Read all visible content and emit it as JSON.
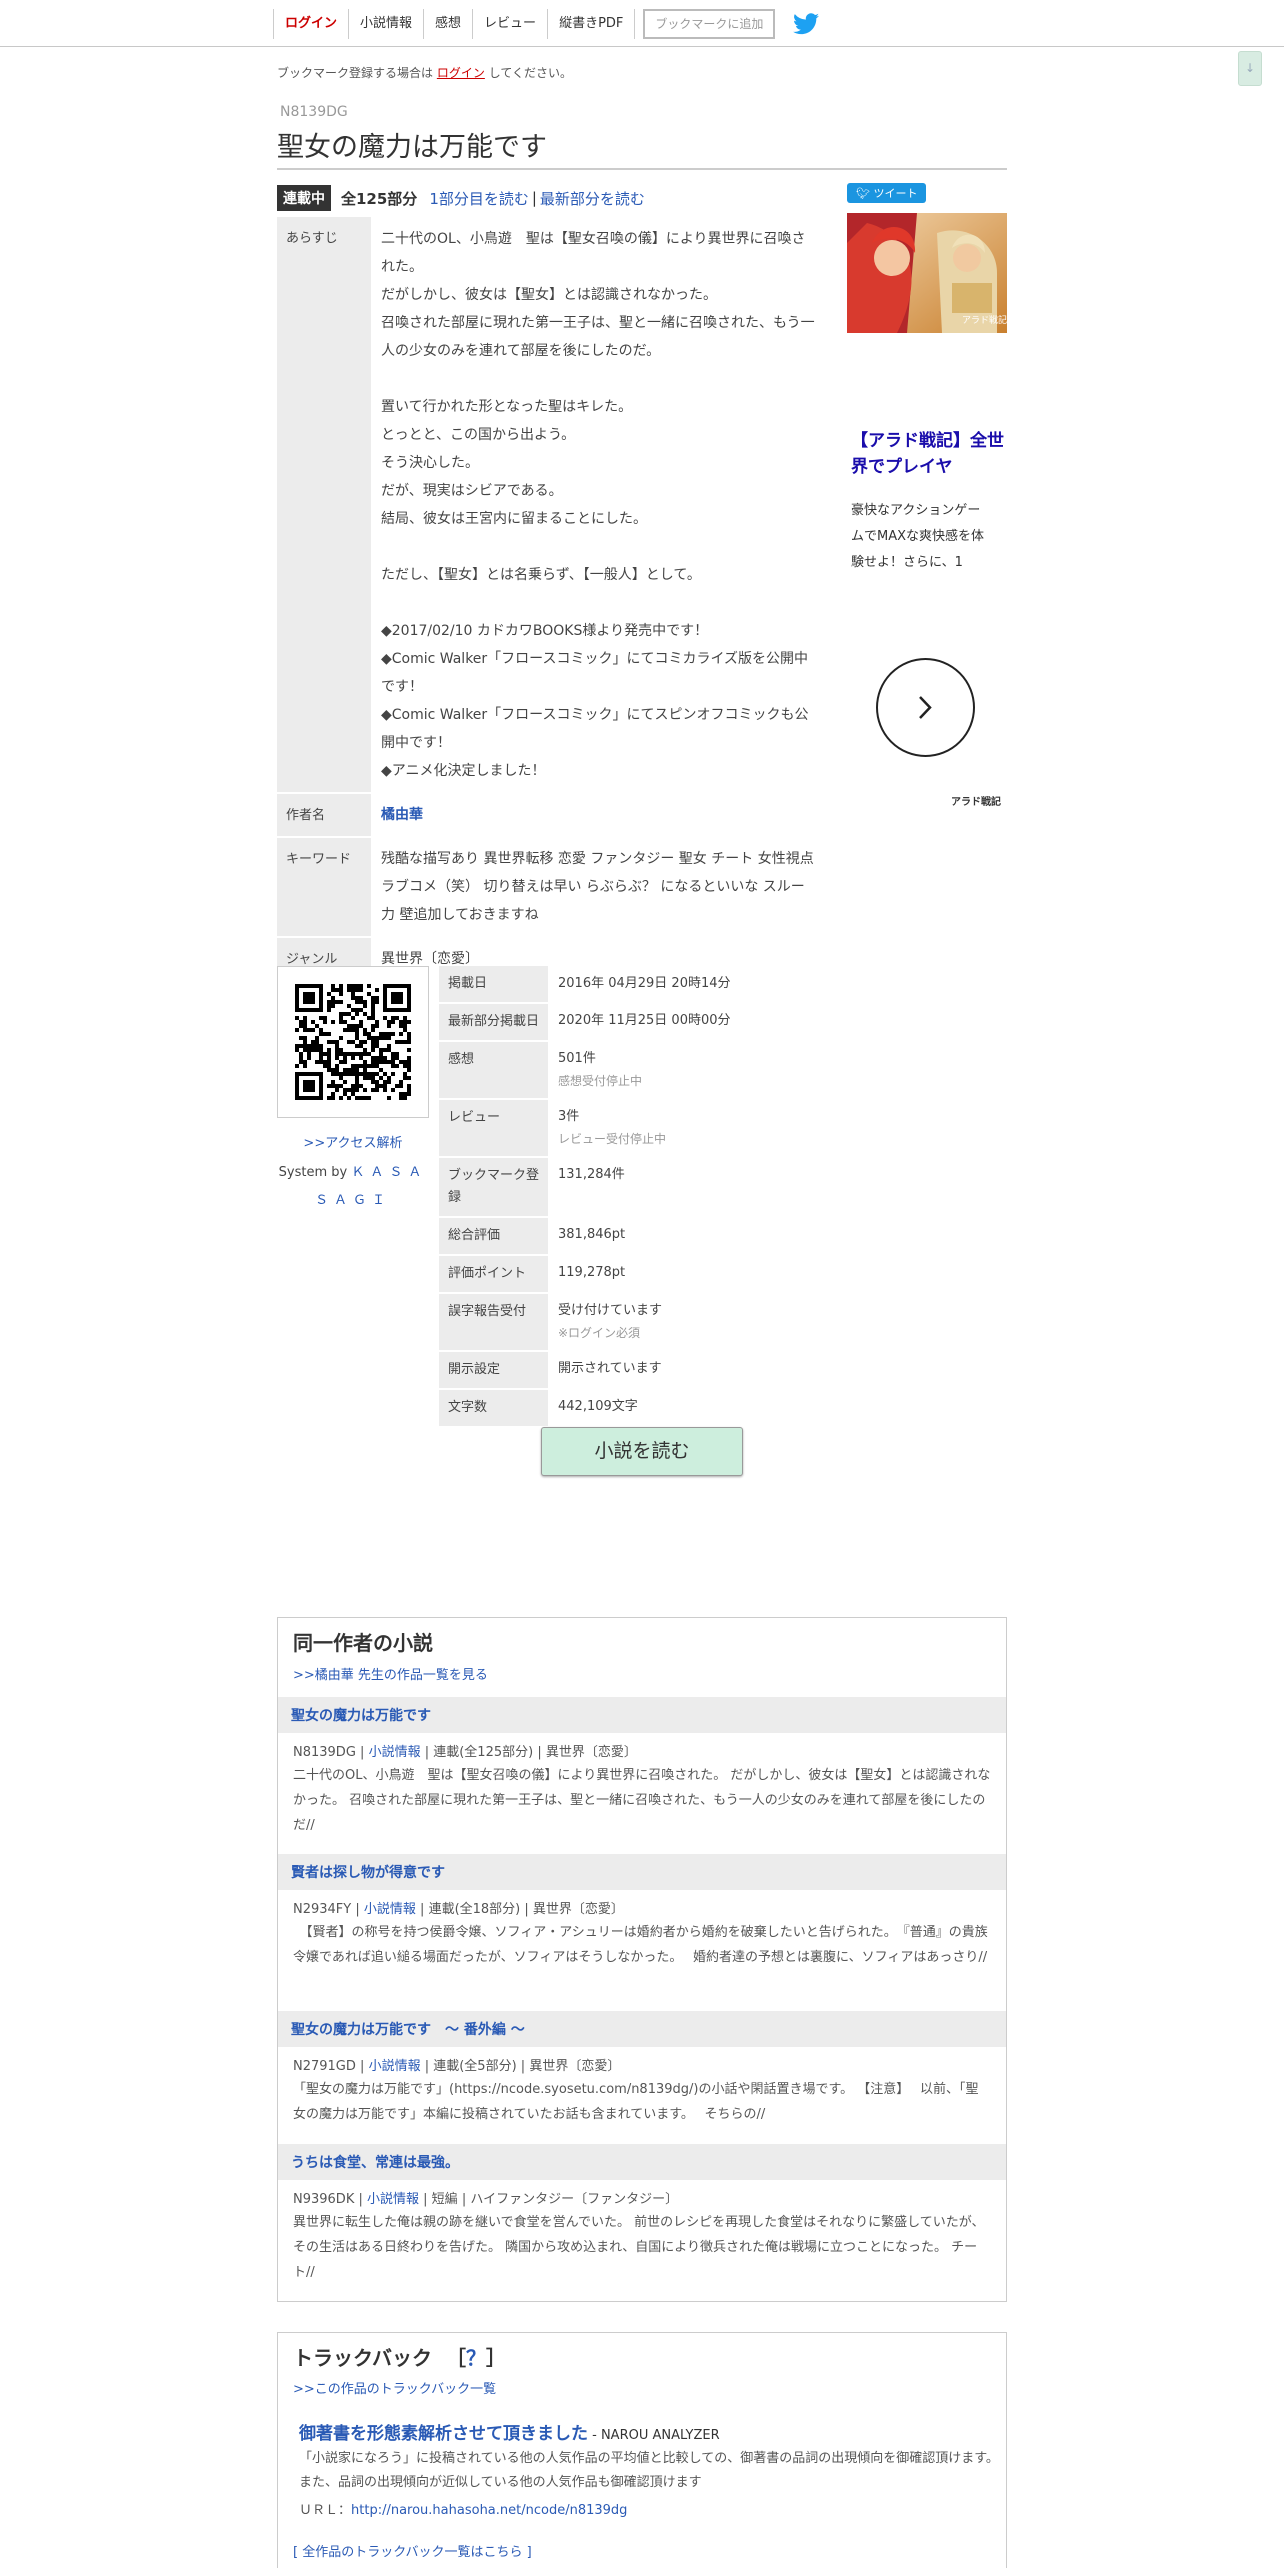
{
  "header": {
    "nav": [
      "ログイン",
      "小説情報",
      "感想",
      "レビュー",
      "縦書きPDF"
    ],
    "bookmark_button": "ブックマークに追加",
    "scroll_top": "↓"
  },
  "login_note": {
    "before": "ブックマーク登録する場合は",
    "link": "ログイン",
    "after": "してください。"
  },
  "novel": {
    "ncode": "N8139DG",
    "title": "聖女の魔力は万能です",
    "status": "連載中",
    "episode_count": "全125部分",
    "read_first": "1部分目を読む",
    "separator": "|",
    "read_latest": "最新部分を読む"
  },
  "info": {
    "synopsis_label": "あらすじ",
    "synopsis_lines": [
      "二十代のOL、小鳥遊　聖は【聖女召喚の儀】により異世界に召喚された。",
      "だがしかし、彼女は【聖女】とは認識されなかった。",
      "召喚された部屋に現れた第一王子は、聖と一緒に召喚された、もう一人の少女のみを連れて部屋を後にしたのだ。",
      "",
      "置いて行かれた形となった聖はキレた。",
      "とっとと、この国から出よう。",
      "そう決心した。",
      "だが、現実はシビアである。",
      "結局、彼女は王宮内に留まることにした。",
      "",
      "ただし、【聖女】とは名乗らず、【一般人】として。",
      "",
      "◆2017/02/10 カドカワBOOKS様より発売中です！",
      "◆Comic Walker「フロースコミック」にてコミカライズ版を公開中です！",
      "◆Comic Walker「フロースコミック」にてスピンオフコミックも公開中です！",
      "◆アニメ化決定しました！"
    ],
    "author_label": "作者名",
    "author": "橘由華",
    "keyword_label": "キーワード",
    "keywords": "残酷な描写あり 異世界転移  恋愛 ファンタジー 聖女 チート 女性視点 ラブコメ（笑） 切り替えは早い らぶらぶ？ になるといいな スルー力 壁追加しておきますね",
    "genre_label": "ジャンル",
    "genre": "異世界〔恋愛〕"
  },
  "ad": {
    "tweet": "ツイート",
    "image_caption": "アラド戦記",
    "title": "【アラド戦記】全世界でプレイヤ",
    "text": "豪快なアクションゲームでMAXな爽快感を体験せよ！さらに、1",
    "source": "アラド戦記"
  },
  "side": {
    "access_link": ">>アクセス解析",
    "system_by": "System by",
    "system_name": "ＫＡＳＡＳＡＧＩ"
  },
  "stats": [
    {
      "label": "掲載日",
      "value": "2016年 04月29日 20時14分",
      "note": ""
    },
    {
      "label": "最新部分掲載日",
      "value": "2020年 11月25日 00時00分",
      "note": ""
    },
    {
      "label": "感想",
      "value": "501件",
      "note": "感想受付停止中"
    },
    {
      "label": "レビュー",
      "value": "3件",
      "note": "レビュー受付停止中"
    },
    {
      "label": "ブックマーク登録",
      "value": "131,284件",
      "note": ""
    },
    {
      "label": "総合評価",
      "value": "381,846pt",
      "note": ""
    },
    {
      "label": "評価ポイント",
      "value": "119,278pt",
      "note": ""
    },
    {
      "label": "誤字報告受付",
      "value": "受け付けています",
      "note": "※ログイン必須"
    },
    {
      "label": "開示設定",
      "value": "開示されています",
      "note": ""
    },
    {
      "label": "文字数",
      "value": "442,109文字",
      "note": ""
    }
  ],
  "read_button": "小説を読む",
  "same_author": {
    "title": "同一作者の小説",
    "list_link": ">>橘由華 先生の作品一覧を見る",
    "works": [
      {
        "title": "聖女の魔力は万能です",
        "ncode": "N8139DG",
        "info_link": "小説情報",
        "type": "連載(全125部分)",
        "genre": "異世界〔恋愛〕",
        "desc": "二十代のOL、小鳥遊　聖は【聖女召喚の儀】により異世界に召喚された。 だがしかし、彼女は【聖女】とは認識されなかった。 召喚された部屋に現れた第一王子は、聖と一緒に召喚された、もう一人の少女のみを連れて部屋を後にしたのだ//"
      },
      {
        "title": "賢者は探し物が得意です",
        "ncode": "N2934FY",
        "info_link": "小説情報",
        "type": "連載(全18部分)",
        "genre": "異世界〔恋愛〕",
        "desc": "　【賢者】の称号を持つ侯爵令嬢、ソフィア・アシュリーは婚約者から婚約を破棄したいと告げられた。　『普通』の貴族令嬢であれば追い縋る場面だったが、ソフィアはそうしなかった。　 婚約者達の予想とは裏腹に、ソフィアはあっさり//"
      },
      {
        "title": "聖女の魔力は万能です　～ 番外編 ～",
        "ncode": "N2791GD",
        "info_link": "小説情報",
        "type": "連載(全5部分)",
        "genre": "異世界〔恋愛〕",
        "desc": "「聖女の魔力は万能です」(https://ncode.syosetu.com/n8139dg/)の小話や閑話置き場です。 【注意】　 以前、「聖女の魔力は万能です」本編に投稿されていたお話も含まれています。　 そちらの//"
      },
      {
        "title": "うちは食堂、常連は最強。",
        "ncode": "N9396DK",
        "info_link": "小説情報",
        "type": "短編",
        "genre": "ハイファンタジー〔ファンタジー〕",
        "desc": "異世界に転生した俺は親の跡を継いで食堂を営んでいた。 前世のレシピを再現した食堂はそれなりに繁盛していたが、その生活はある日終わりを告げた。 隣国から攻め込まれ、自国により徴兵された俺は戦場に立つことになった。 チート//"
      }
    ]
  },
  "trackback": {
    "title": "トラックバック",
    "help_open": "［",
    "help": "？",
    "help_close": "］",
    "list_link": ">>この作品のトラックバック一覧",
    "entry_title": "御著書を形態素解析させて頂きました",
    "entry_site": " - NAROU ANALYZER",
    "entry_desc": "「小説家になろう」に投稿されている他の人気作品の平均値と比較しての、御著書の品詞の出現傾向を御確認頂けます。また、品詞の出現傾向が近似している他の人気作品も御確認頂けます",
    "url_label": "ＵＲＬ：",
    "url": "http://narou.hahasoha.net/ncode/n8139dg",
    "all_link": "[ 全作品のトラックバック一覧はこちら ]"
  },
  "colors": {
    "link": "#2a5ab5",
    "accent_red": "#cc0000",
    "badge": "#333333",
    "button_green": "#cdeedd",
    "twitter": "#1b95e0"
  }
}
